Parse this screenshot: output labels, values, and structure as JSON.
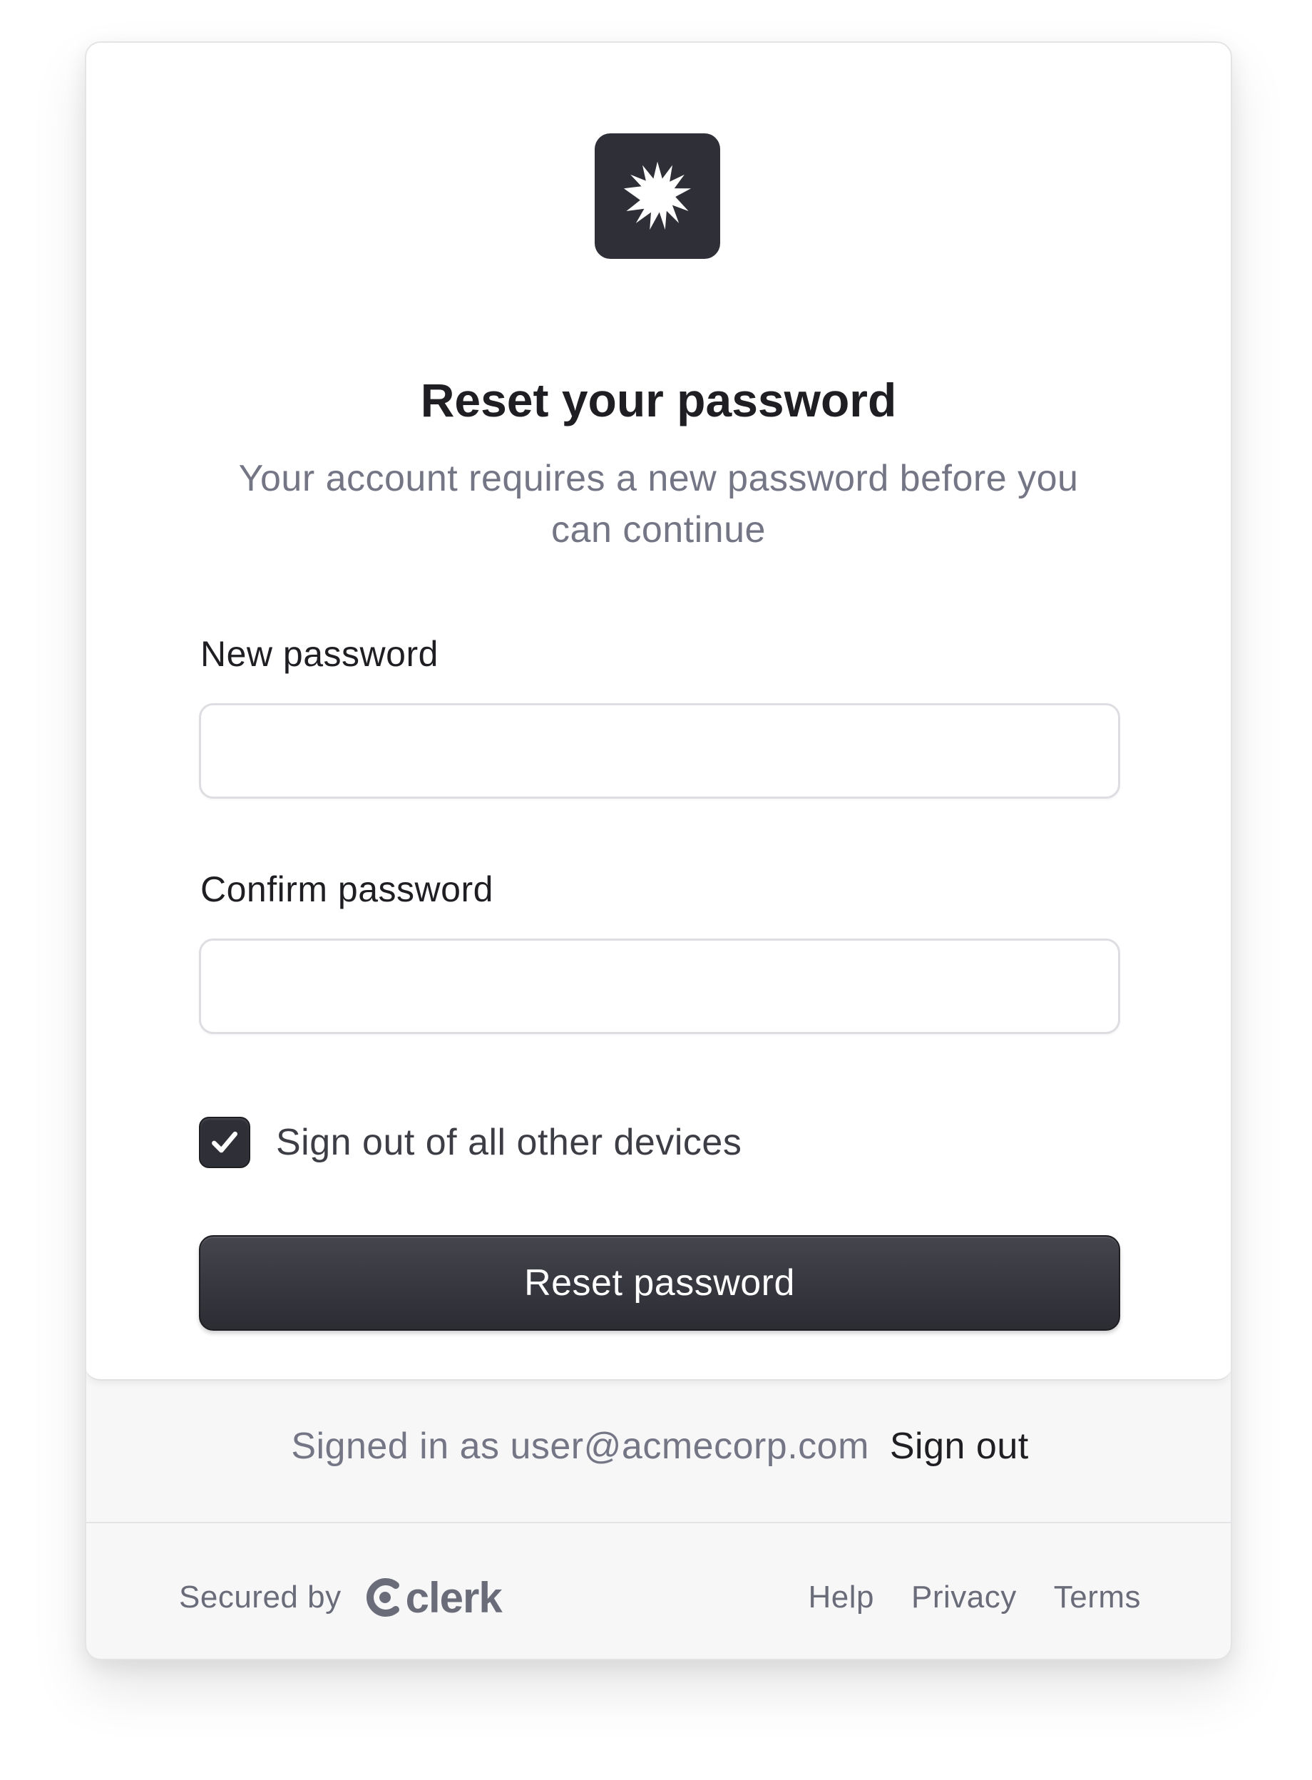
{
  "header": {
    "logo_icon": "starburst-icon",
    "title": "Reset your password",
    "subtitle": "Your account requires a new password before you can continue"
  },
  "form": {
    "new_password_label": "New password",
    "new_password_value": "",
    "confirm_password_label": "Confirm password",
    "confirm_password_value": "",
    "sign_out_devices_label": "Sign out of all other devices",
    "sign_out_devices_checked": true,
    "submit_label": "Reset password"
  },
  "session": {
    "signed_in_prefix": "Signed in as",
    "email": "user@acmecorp.com",
    "sign_out_label": "Sign out"
  },
  "footer": {
    "secured_by": "Secured by",
    "brand": "clerk",
    "links": [
      "Help",
      "Privacy",
      "Terms"
    ]
  },
  "colors": {
    "primary": "#2f3037",
    "muted_text": "#747686",
    "card_background": "#ffffff",
    "footer_background": "#f7f7f8"
  }
}
